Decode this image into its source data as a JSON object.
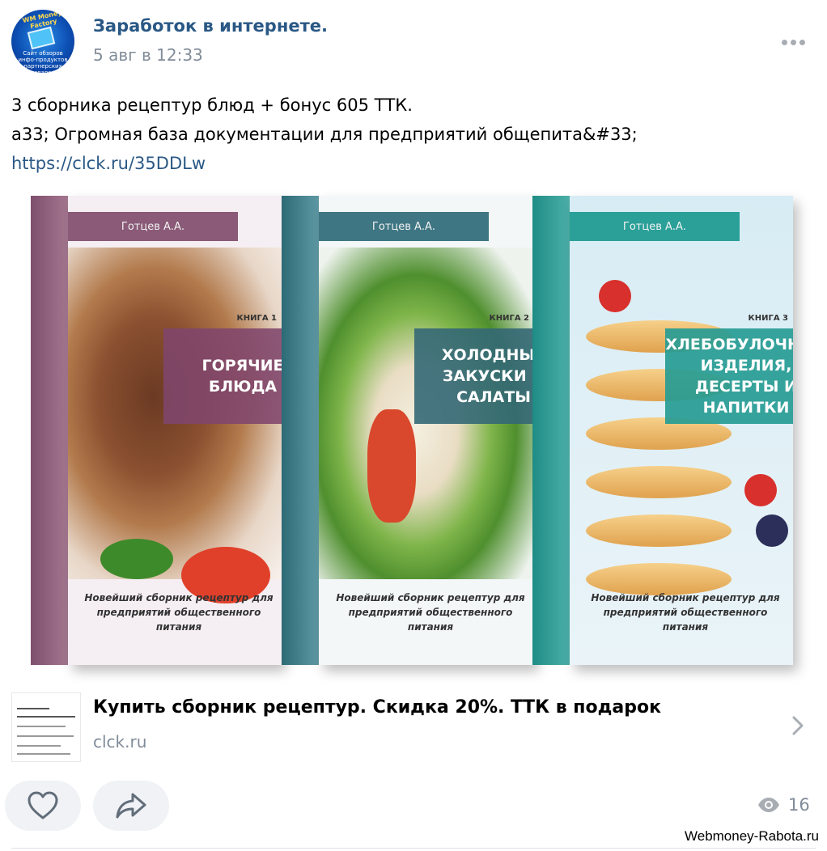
{
  "post": {
    "group_name": "Заработок в интернете.",
    "date": "5 авг в 12:33",
    "avatar_text_top": "WM Money Factory",
    "avatar_text_bottom": "Сайт обзоров инфо-продуктов партнерских товаров",
    "text_line1": "3 сборника рецептур блюд + бонус 605 ТТК.",
    "text_line2": "a33; Огромная база документации для предприятий общепита&#33;",
    "link_url": "https://clck.ru/35DDLw"
  },
  "books": [
    {
      "author": "Готцев А.А.",
      "number": "КНИГА 1",
      "title": "ГОРЯЧИЕ БЛЮДА",
      "subtitle": "Новейший сборник рецептур для предприятий общественного питания"
    },
    {
      "author": "Готцев А.А.",
      "number": "КНИГА 2",
      "title": "ХОЛОДНЫЕ ЗАКУСКИ И САЛАТЫ",
      "subtitle": "Новейший сборник рецептур для предприятий общественного питания"
    },
    {
      "author": "Готцев А.А.",
      "number": "КНИГА 3",
      "title": "ХЛЕБОБУЛОЧНЫЕ ИЗДЕЛИЯ, ДЕСЕРТЫ И НАПИТКИ",
      "subtitle": "Новейший сборник рецептур для предприятий общественного питания"
    }
  ],
  "link_snippet": {
    "title": "Купить сборник рецептур. Скидка 20%. ТТК в подарок",
    "domain": "clck.ru"
  },
  "actions": {
    "like_icon": "heart-icon",
    "share_icon": "share-arrow-icon",
    "views_icon": "eye-icon",
    "views_count": "16"
  },
  "watermark": "Webmoney-Rabota.ru",
  "colors": {
    "link": "#2a5885",
    "muted": "#818c99",
    "button_bg": "#f0f2f5"
  }
}
